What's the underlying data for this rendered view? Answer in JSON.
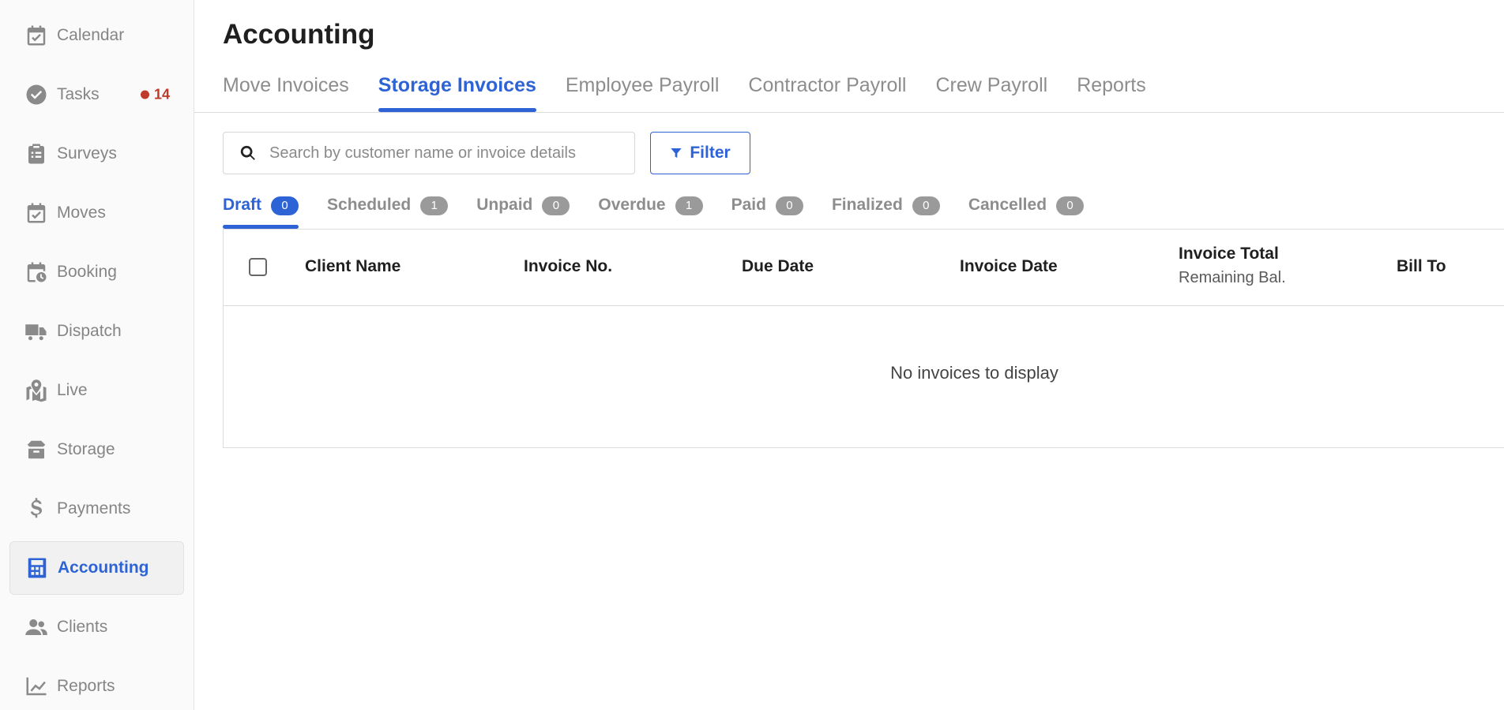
{
  "sidebar": {
    "items": [
      {
        "label": "Calendar",
        "icon": "calendar-check-icon"
      },
      {
        "label": "Tasks",
        "icon": "check-circle-icon",
        "badge": "14"
      },
      {
        "label": "Surveys",
        "icon": "clipboard-list-icon"
      },
      {
        "label": "Moves",
        "icon": "calendar-check-icon"
      },
      {
        "label": "Booking",
        "icon": "calendar-clock-icon"
      },
      {
        "label": "Dispatch",
        "icon": "truck-icon"
      },
      {
        "label": "Live",
        "icon": "map-pin-icon"
      },
      {
        "label": "Storage",
        "icon": "box-icon"
      },
      {
        "label": "Payments",
        "icon": "dollar-icon"
      },
      {
        "label": "Accounting",
        "icon": "calculator-icon",
        "active": true
      },
      {
        "label": "Clients",
        "icon": "users-icon"
      },
      {
        "label": "Reports",
        "icon": "line-chart-icon"
      }
    ]
  },
  "page": {
    "title": "Accounting"
  },
  "tabs": [
    {
      "label": "Move Invoices"
    },
    {
      "label": "Storage Invoices",
      "active": true
    },
    {
      "label": "Employee Payroll"
    },
    {
      "label": "Contractor Payroll"
    },
    {
      "label": "Crew Payroll"
    },
    {
      "label": "Reports"
    }
  ],
  "search": {
    "placeholder": "Search by customer name or invoice details",
    "value": ""
  },
  "filter": {
    "label": "Filter"
  },
  "status_tabs": [
    {
      "label": "Draft",
      "count": "0",
      "active": true
    },
    {
      "label": "Scheduled",
      "count": "1"
    },
    {
      "label": "Unpaid",
      "count": "0"
    },
    {
      "label": "Overdue",
      "count": "1"
    },
    {
      "label": "Paid",
      "count": "0"
    },
    {
      "label": "Finalized",
      "count": "0"
    },
    {
      "label": "Cancelled",
      "count": "0"
    }
  ],
  "table": {
    "columns": {
      "client_name": "Client Name",
      "invoice_no": "Invoice No.",
      "due_date": "Due Date",
      "invoice_date": "Invoice Date",
      "invoice_total": "Invoice Total",
      "remaining_bal": "Remaining Bal.",
      "bill_to": "Bill To"
    },
    "empty_message": "No invoices to display"
  },
  "colors": {
    "accent": "#2e63d6",
    "badge_alert": "#c0392b",
    "muted": "#8d8d8d"
  }
}
